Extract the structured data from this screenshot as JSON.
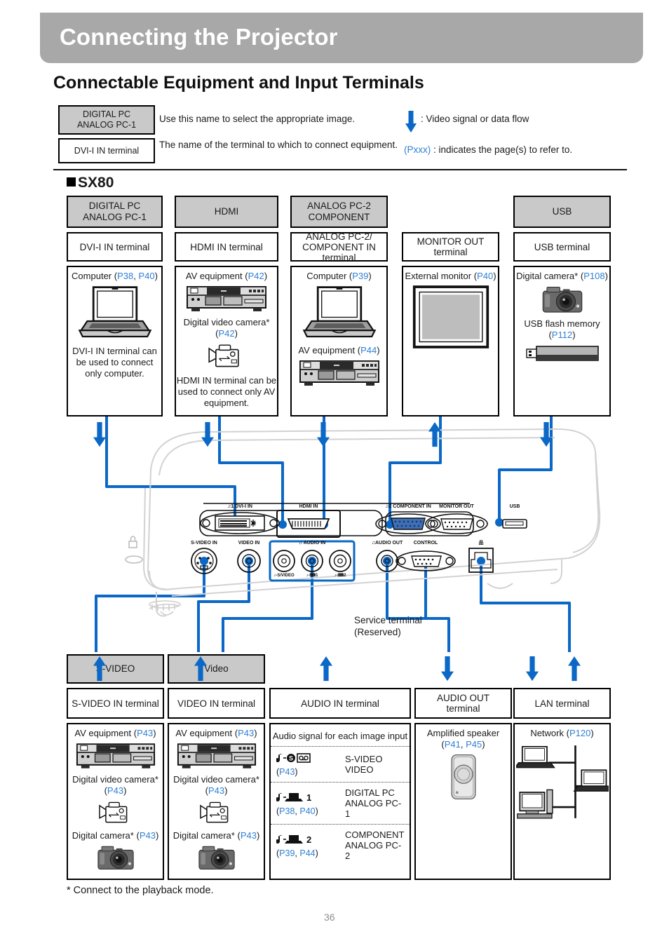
{
  "header": {
    "title": "Connecting the Projector",
    "heading": "Connectable Equipment and Input Terminals",
    "legend": {
      "box1": "DIGITAL PC\nANALOG PC-1",
      "box1_line1": "DIGITAL PC",
      "box1_line2": "ANALOG PC-1",
      "text1": "Use this name to select the appropriate image.",
      "box2": "DVI-I IN terminal",
      "text2": "The name of the terminal to which to connect equipment.",
      "arrow_text": ": Video signal or data flow",
      "page_ref_prefix": "(Pxxx)",
      "page_ref_text": " : indicates the page(s) to refer to."
    },
    "model": "SX80"
  },
  "top_columns": [
    {
      "header_lines": [
        "DIGITAL PC",
        "ANALOG PC-1"
      ],
      "terminal_lines": [
        "DVI-I IN terminal"
      ],
      "items": [
        {
          "label": "Computer",
          "pages": [
            "P38",
            "P40"
          ],
          "icon": "laptop-icon"
        }
      ],
      "note": "DVI-I IN terminal can be used to connect only computer.",
      "arrow": "down"
    },
    {
      "header_lines": [
        "HDMI"
      ],
      "terminal_lines": [
        "HDMI IN terminal"
      ],
      "items": [
        {
          "label": "AV equipment",
          "pages": [
            "P42"
          ],
          "icon": "av-deck-icon"
        },
        {
          "label": "Digital video camera*",
          "pages": [
            "P42"
          ],
          "icon": "camcorder-icon"
        }
      ],
      "note": "HDMI IN terminal can be used to connect only AV equipment.",
      "arrow": "down"
    },
    {
      "header_lines": [
        "ANALOG PC-2",
        "COMPONENT"
      ],
      "terminal_lines": [
        "ANALOG PC-2/",
        "COMPONENT IN",
        "terminal"
      ],
      "items": [
        {
          "label": "Computer",
          "pages": [
            "P39"
          ],
          "icon": "laptop-icon"
        },
        {
          "label": "AV equipment",
          "pages": [
            "P44"
          ],
          "icon": "av-deck-icon"
        }
      ],
      "note": "",
      "arrow": "down"
    },
    {
      "header_lines": [],
      "terminal_lines": [
        "MONITOR OUT",
        "terminal"
      ],
      "items": [
        {
          "label": "External monitor",
          "pages": [
            "P40"
          ],
          "icon": "monitor-icon"
        }
      ],
      "note": "",
      "arrow": "up"
    },
    {
      "header_lines": [
        "USB"
      ],
      "terminal_lines": [
        "USB terminal"
      ],
      "items": [
        {
          "label": "Digital camera*",
          "pages": [
            "P108"
          ],
          "icon": "dslr-camera-icon"
        },
        {
          "label": "USB flash memory",
          "pages": [
            "P112"
          ],
          "icon": "usb-stick-icon"
        }
      ],
      "note": "",
      "arrow": "down"
    }
  ],
  "bottom_columns": [
    {
      "header_lines": [
        "S-VIDEO"
      ],
      "terminal_lines": [
        "S-VIDEO IN terminal"
      ],
      "items": [
        {
          "label": "AV equipment",
          "pages": [
            "P43"
          ],
          "icon": "av-deck-icon"
        },
        {
          "label": "Digital video camera*",
          "pages": [
            "P43"
          ],
          "icon": "camcorder-icon"
        },
        {
          "label": "Digital camera*",
          "pages": [
            "P43"
          ],
          "icon": "dslr-camera-icon"
        }
      ],
      "arrow": "up"
    },
    {
      "header_lines": [
        "Video"
      ],
      "terminal_lines": [
        "VIDEO IN terminal"
      ],
      "items": [
        {
          "label": "AV equipment",
          "pages": [
            "P43"
          ],
          "icon": "av-deck-icon"
        },
        {
          "label": "Digital video camera*",
          "pages": [
            "P43"
          ],
          "icon": "camcorder-icon"
        },
        {
          "label": "Digital camera*",
          "pages": [
            "P43"
          ],
          "icon": "dslr-camera-icon"
        }
      ],
      "arrow": "up"
    },
    {
      "header_lines": [],
      "terminal_lines": [
        "AUDIO IN terminal"
      ],
      "title": "Audio signal for each image input",
      "rows": [
        {
          "icon": "audio-svideo-icon",
          "pages": [
            "P43"
          ],
          "names": [
            "S-VIDEO",
            "VIDEO"
          ]
        },
        {
          "icon": "audio-pc1-icon",
          "pages": [
            "P38",
            "P40"
          ],
          "names": [
            "DIGITAL PC",
            "ANALOG PC-1"
          ]
        },
        {
          "icon": "audio-pc2-icon",
          "pages": [
            "P39",
            "P44"
          ],
          "names": [
            "COMPONENT",
            "ANALOG PC-2"
          ]
        }
      ],
      "arrow": "up"
    },
    {
      "header_lines": [],
      "terminal_lines": [
        "AUDIO OUT",
        "terminal"
      ],
      "items": [
        {
          "label": "Amplified speaker",
          "pages": [
            "P41",
            "P45"
          ],
          "icon": "speaker-icon"
        }
      ],
      "arrow": "down"
    },
    {
      "header_lines": [],
      "terminal_lines": [
        "LAN terminal"
      ],
      "items": [
        {
          "label": "Network",
          "pages": [
            "P120"
          ],
          "icon": "network-icon"
        }
      ],
      "arrow": "both"
    }
  ],
  "projector": {
    "panel_labels_top": [
      "DVI-I IN",
      "HDMI IN",
      "COMPONENT IN",
      "MONITOR OUT"
    ],
    "panel_labels_bottom": [
      "S-VIDEO IN",
      "VIDEO IN",
      "AUDIO IN",
      "AUDIO OUT",
      "CONTROL"
    ],
    "audio_sub_labels": [
      "S/VIDEO",
      "1",
      "2"
    ],
    "service_note": "Service terminal\n(Reserved)",
    "service_note_l1": "Service terminal",
    "service_note_l2": "(Reserved)"
  },
  "footer": {
    "footnote": "* Connect to the playback mode.",
    "page_number": "36"
  },
  "colors": {
    "accent_blue": "#0b68c6",
    "page_ref_blue": "#2f7fd4",
    "header_gray": "#c9c9c9",
    "title_gray": "#a8a8a8"
  }
}
